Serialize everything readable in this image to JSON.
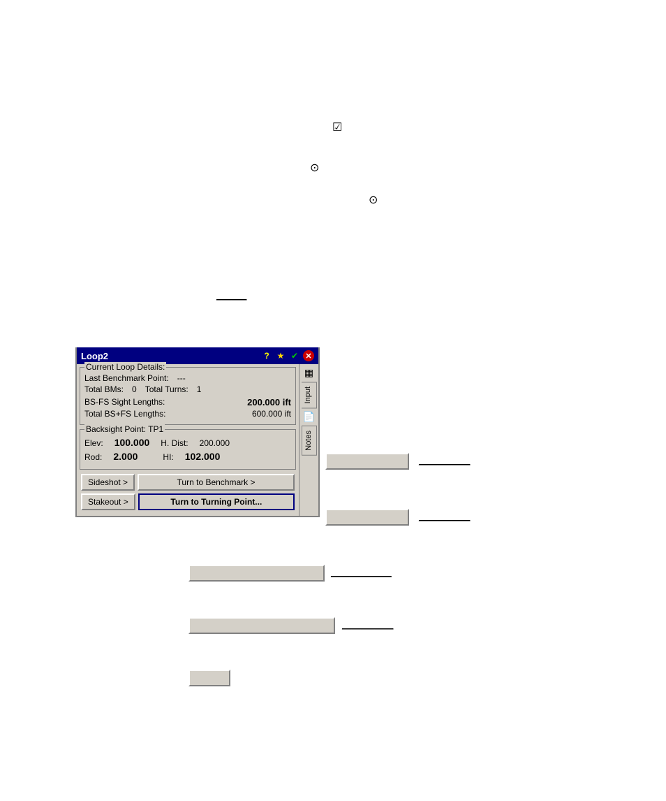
{
  "window": {
    "title": "Loop2",
    "icons": {
      "help": "?",
      "star": "★",
      "check": "✔",
      "close": "✕"
    }
  },
  "current_loop": {
    "group_label": "Current Loop Details:",
    "last_benchmark_label": "Last Benchmark Point:",
    "last_benchmark_value": "---",
    "total_bms_label": "Total BMs:",
    "total_bms_value": "0",
    "total_turns_label": "Total Turns:",
    "total_turns_value": "1",
    "bs_fs_label": "BS-FS Sight Lengths:",
    "bs_fs_value": "200.000 ift",
    "total_bs_fs_label": "Total BS+FS Lengths:",
    "total_bs_fs_value": "600.000 ift"
  },
  "backsight": {
    "group_label": "Backsight Point: TP1",
    "elev_label": "Elev:",
    "elev_value": "100.000",
    "h_dist_label": "H. Dist:",
    "h_dist_value": "200.000",
    "rod_label": "Rod:",
    "rod_value": "2.000",
    "hi_label": "HI:",
    "hi_value": "102.000"
  },
  "buttons": {
    "sideshot": "Sideshot >",
    "turn_to_benchmark": "Turn to Benchmark >",
    "stakeout": "Stakeout >",
    "turn_to_turning_point": "Turn to Turning Point..."
  },
  "tabs": {
    "input": "Input",
    "notes": "Notes"
  },
  "scattered": {
    "underline_415": "______",
    "underline_660": "______",
    "underline_740": "______",
    "underline_820": "________",
    "underline_895": "_______"
  },
  "checkbox_symbol": "☑",
  "radio_symbol_1": "⊙",
  "radio_symbol_2": "⊙"
}
